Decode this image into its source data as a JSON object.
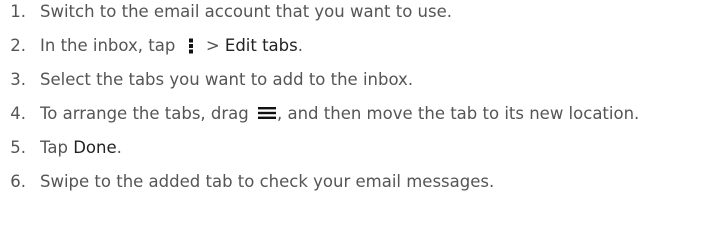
{
  "steps": [
    {
      "number": "1.",
      "text": "Switch to the email account that you want to use."
    },
    {
      "number": "2.",
      "prefix": "In the inbox, tap",
      "icon": "kebab-menu-icon",
      "separator": ">",
      "action": "Edit tabs",
      "suffix": "."
    },
    {
      "number": "3.",
      "text": "Select the tabs you want to add to the inbox."
    },
    {
      "number": "4.",
      "prefix": "To arrange the tabs, drag",
      "icon": "drag-handle-icon",
      "suffix": ", and then move the tab to its new location."
    },
    {
      "number": "5.",
      "prefix": "Tap",
      "action": "Done",
      "suffix": "."
    },
    {
      "number": "6.",
      "text": "Swipe to the added tab to check your email messages."
    }
  ]
}
